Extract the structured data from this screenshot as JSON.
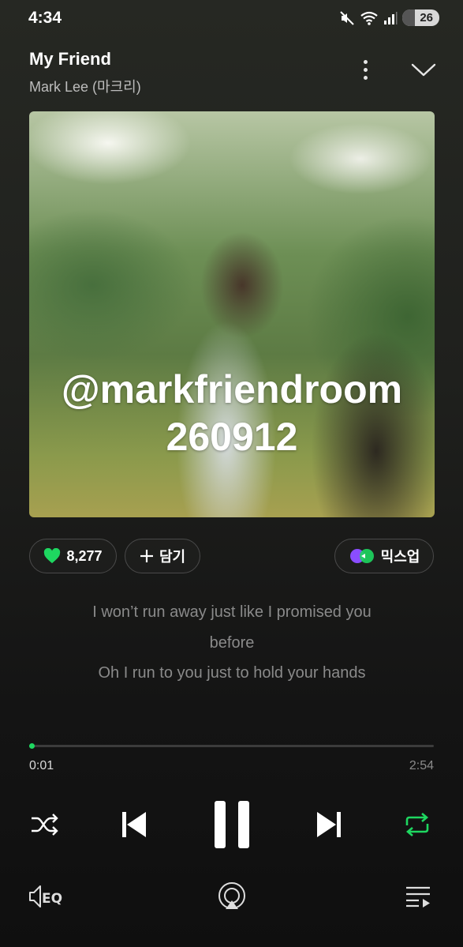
{
  "status_bar": {
    "time": "4:34",
    "battery": "26"
  },
  "header": {
    "title": "My Friend",
    "artist": "Mark Lee (마크리)"
  },
  "album": {
    "watermark_line1": "@markfriendroom",
    "watermark_line2": "260912"
  },
  "actions": {
    "like_count": "8,277",
    "add_label": "담기",
    "mixup_label": "믹스업"
  },
  "lyrics": [
    "I won’t run away just like I promised you",
    "before",
    "Oh I run to you just to hold your hands"
  ],
  "player": {
    "current_time": "0:01",
    "total_time": "2:54",
    "progress_fraction": 0.006
  },
  "colors": {
    "accent": "#1ed760",
    "background": "#1b1b1b",
    "lyrics_text": "#8a8a8a"
  },
  "icons": {
    "more": "more-vertical-icon",
    "collapse": "chevron-down-icon",
    "like": "heart-icon",
    "add": "plus-icon",
    "mixup": "mixup-icon",
    "shuffle": "shuffle-icon",
    "prev": "skip-previous-icon",
    "pause": "pause-icon",
    "next": "skip-next-icon",
    "repeat": "repeat-icon",
    "eq": "eq-icon",
    "cast": "cast-icon",
    "queue": "queue-icon"
  }
}
